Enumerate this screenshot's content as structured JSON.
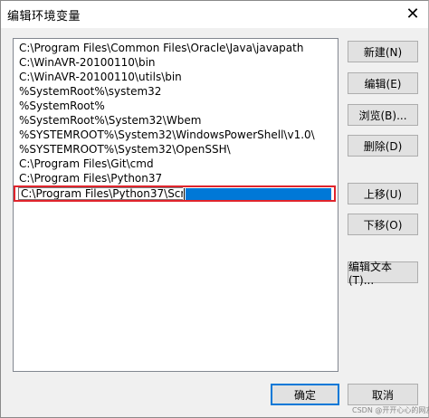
{
  "window": {
    "title": "编辑环境变量",
    "close_glyph": "✕"
  },
  "list": {
    "items": [
      "C:\\Program Files\\Common Files\\Oracle\\Java\\javapath",
      "C:\\WinAVR-20100110\\bin",
      "C:\\WinAVR-20100110\\utils\\bin",
      "%SystemRoot%\\system32",
      "%SystemRoot%",
      "%SystemRoot%\\System32\\Wbem",
      "%SYSTEMROOT%\\System32\\WindowsPowerShell\\v1.0\\",
      "%SYSTEMROOT%\\System32\\OpenSSH\\",
      "C:\\Program Files\\Git\\cmd",
      "C:\\Program Files\\Python37"
    ],
    "editing_value": "C:\\Program Files\\Python37\\Scripts"
  },
  "buttons": {
    "new": "新建(N)",
    "edit": "编辑(E)",
    "browse": "浏览(B)...",
    "delete": "删除(D)",
    "move_up": "上移(U)",
    "move_down": "下移(O)",
    "edit_text": "编辑文本(T)...",
    "ok": "确定",
    "cancel": "取消"
  },
  "watermark": "CSDN @开开心心的网友",
  "colors": {
    "highlight_border": "#e0242c",
    "selection": "#0078d7",
    "button_bg": "#e1e1e1"
  }
}
